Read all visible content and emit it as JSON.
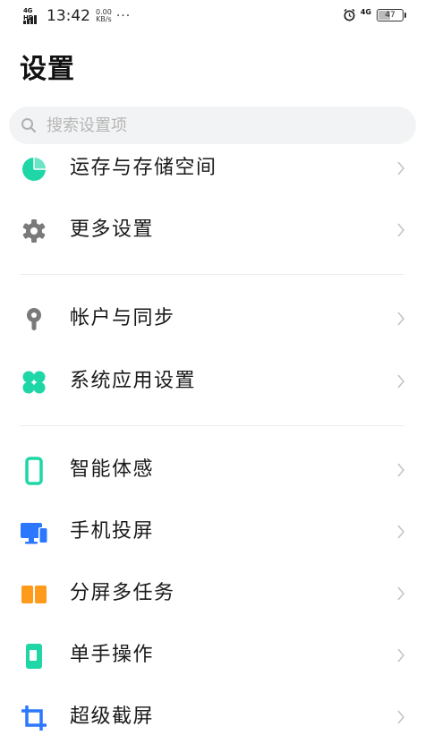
{
  "status_bar": {
    "network": "4G HD",
    "time": "13:42",
    "speed_value": "0.00",
    "speed_unit": "KB/s",
    "more": "···",
    "network_right": "4G",
    "battery": "47"
  },
  "page": {
    "title": "设置"
  },
  "search": {
    "placeholder": "搜索设置项"
  },
  "sections": [
    {
      "items": [
        {
          "label": "运存与存储空间",
          "icon": "pie-chart-icon",
          "color": "#1ed6a6"
        },
        {
          "label": "更多设置",
          "icon": "gear-icon",
          "color": "#7a7a7a"
        }
      ]
    },
    {
      "items": [
        {
          "label": "帐户与同步",
          "icon": "location-pin-icon",
          "color": "#7a7a7a"
        },
        {
          "label": "系统应用设置",
          "icon": "clover-icon",
          "color": "#1ed6a6"
        }
      ]
    },
    {
      "items": [
        {
          "label": "智能体感",
          "icon": "phone-outline-icon",
          "color": "#1ed6a6"
        },
        {
          "label": "手机投屏",
          "icon": "screen-cast-icon",
          "color": "#2b78ff"
        },
        {
          "label": "分屏多任务",
          "icon": "split-screen-icon",
          "color": "#ff9a1a"
        },
        {
          "label": "单手操作",
          "icon": "one-hand-icon",
          "color": "#1ed6a6"
        },
        {
          "label": "超级截屏",
          "icon": "screenshot-icon",
          "color": "#2b78ff"
        }
      ]
    }
  ]
}
